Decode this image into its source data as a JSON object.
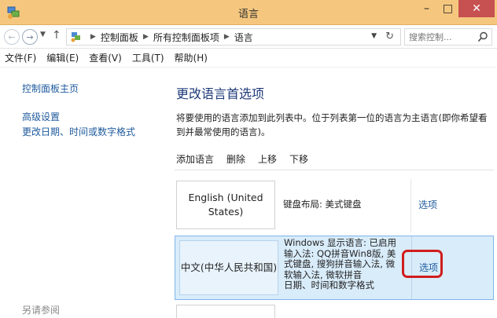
{
  "window": {
    "title": "语言",
    "minimize": "–",
    "maximize": "□",
    "close": "✕"
  },
  "address": {
    "breadcrumbs": [
      "控制面板",
      "所有控制面板项",
      "语言"
    ],
    "search_placeholder": "搜索控制..."
  },
  "menu": [
    "文件(F)",
    "编辑(E)",
    "查看(V)",
    "工具(T)",
    "帮助(H)"
  ],
  "sidebar": {
    "home_link": "控制面板主页",
    "links": [
      "高级设置",
      "更改日期、时间或数字格式"
    ],
    "see_also": "另请参阅"
  },
  "main": {
    "title": "更改语言首选项",
    "description": "将要使用的语言添加到此列表中。位于列表第一位的语言为主语言(即你希望看到并最常使用的语言)。",
    "toolbar": [
      "添加语言",
      "删除",
      "上移",
      "下移"
    ],
    "languages": [
      {
        "name": "English (United States)",
        "info": [
          "键盘布局: 美式键盘"
        ],
        "options": "选项"
      },
      {
        "name": "中文(中华人民共和国)",
        "info": [
          "Windows 显示语言: 已启用",
          "输入法: QQ拼音Win8版, 美",
          "式键盘, 搜狗拼音输入法, 微",
          "软输入法, 微软拼音",
          "日期、时间和数字格式"
        ],
        "options": "选项"
      }
    ]
  },
  "colors": {
    "titlebar": "#f5c77e",
    "close_button": "#c75050",
    "link": "#1e5a9c",
    "heading": "#1e3a78",
    "selected_row": "#d9ecfa",
    "annotation_red": "#d11d1d"
  }
}
